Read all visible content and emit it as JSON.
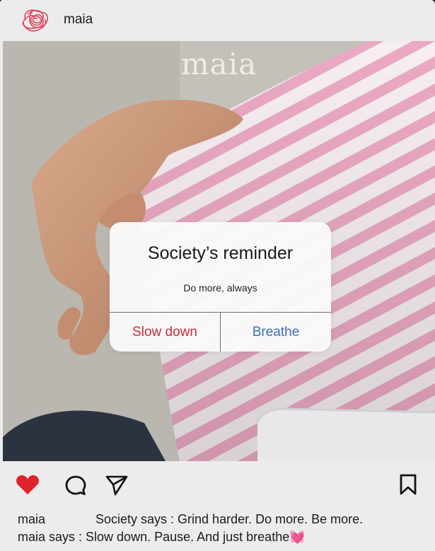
{
  "header": {
    "username": "maia",
    "avatar_icon": "tangled-scribble-logo-icon"
  },
  "photo": {
    "brand_text": "maia",
    "alert": {
      "title": "Society’s reminder",
      "message": "Do more, always",
      "left_button": "Slow down",
      "right_button": "Breathe"
    }
  },
  "actions": {
    "like_icon": "heart-icon",
    "like_color": "#e0222b",
    "comment_icon": "comment-icon",
    "share_icon": "send-icon",
    "save_icon": "bookmark-icon"
  },
  "caption": {
    "username": "maia",
    "text_line1": "Society says : Grind harder. Do more. Be more.",
    "text_line2": "maia says : Slow down. Pause. And just breathe",
    "emoji": "💓"
  },
  "colors": {
    "alert_destructive": "#c62d3a",
    "alert_default": "#3e6fb0",
    "stripe_pink": "#eba9c4"
  }
}
